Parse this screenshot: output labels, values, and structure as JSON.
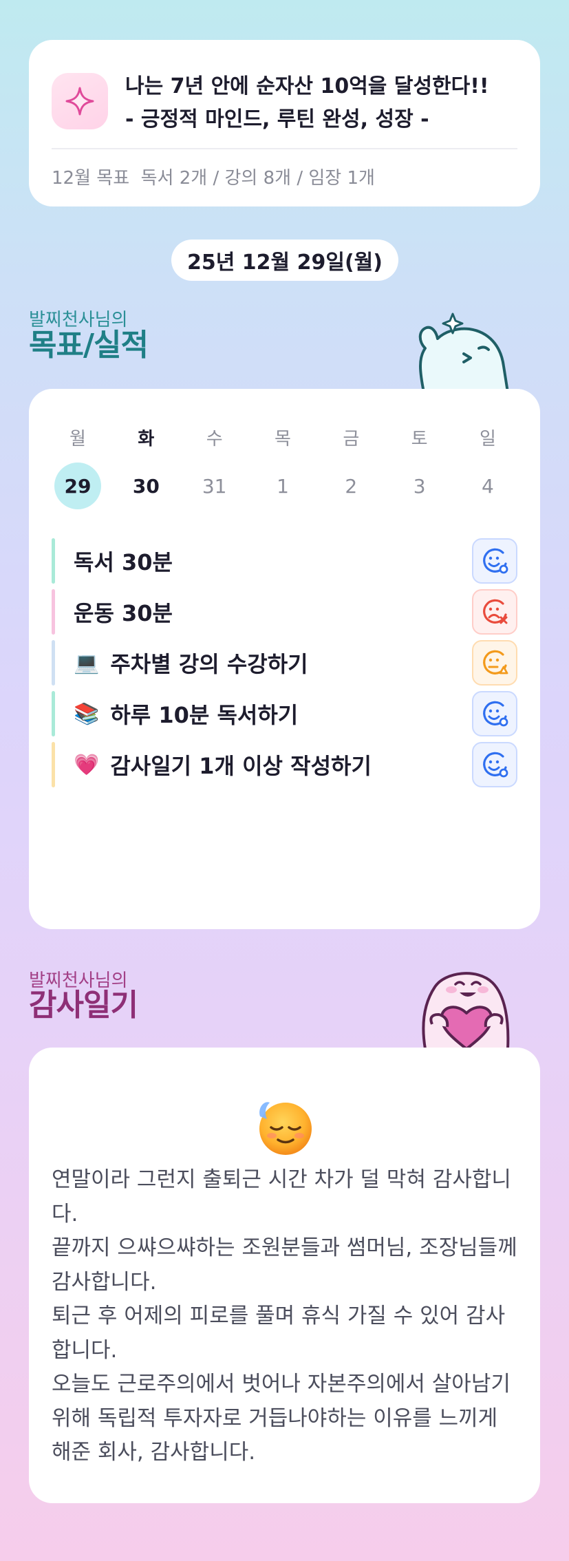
{
  "goal": {
    "icon": "sparkle-icon",
    "title_line1": "나는 7년 안에 순자산 10억을 달성한다!!",
    "title_line2": "- 긍정적 마인드, 루틴 완성, 성장 -",
    "monthly": "12월 목표  독서 2개 / 강의 8개 / 임장 1개"
  },
  "date_label": "25년 12월 29일(월)",
  "goals_section": {
    "owner_label": "발찌천사님의",
    "title": "목표/실적",
    "mascot": "waving-ghost-icon"
  },
  "calendar": {
    "weekdays": [
      "월",
      "화",
      "수",
      "목",
      "금",
      "토",
      "일"
    ],
    "days": [
      "29",
      "30",
      "31",
      "1",
      "2",
      "3",
      "4"
    ],
    "selected_index": 0
  },
  "tasks": [
    {
      "emoji": "",
      "label": "독서 30분",
      "bar_color": "#a9ead8",
      "status": "success",
      "status_icon": "smile-check-icon"
    },
    {
      "emoji": "",
      "label": "운동 30분",
      "bar_color": "#f7c3df",
      "status": "fail",
      "status_icon": "sad-x-icon"
    },
    {
      "emoji": "💻",
      "label": "주차별 강의 수강하기",
      "bar_color": "#cfe0f3",
      "status": "partial",
      "status_icon": "neutral-triangle-icon"
    },
    {
      "emoji": "📚",
      "label": "하루 10분 독서하기",
      "bar_color": "#a9ead8",
      "status": "success",
      "status_icon": "smile-check-icon"
    },
    {
      "emoji": "💗",
      "label": "감사일기 1개 이상 작성하기",
      "bar_color": "#fbe1a8",
      "status": "success",
      "status_icon": "smile-check-icon"
    }
  ],
  "gratitude_section": {
    "owner_label": "발찌천사님의",
    "title": "감사일기",
    "mascot": "heart-ghost-icon"
  },
  "diary": {
    "emoji": "relieved-face-icon",
    "text": "연말이라 그런지 출퇴근 시간 차가 덜 막혀 감사합니다.\n끝까지 으쌰으쌰하는 조원분들과 썸머님, 조장님들께 감사합니다.\n퇴근 후 어제의 피로를 풀며 휴식 가질 수 있어 감사합니다.\n오늘도 근로주의에서 벗어나 자본주의에서 살아남기 위해 독립적 투자자로 거듭나야하는 이유를 느끼게 해준 회사, 감사합니다."
  },
  "colors": {
    "success": "#2f6ff0",
    "fail": "#e94b3c",
    "partial": "#f39a1c",
    "selected_day": "#bfeef2"
  }
}
